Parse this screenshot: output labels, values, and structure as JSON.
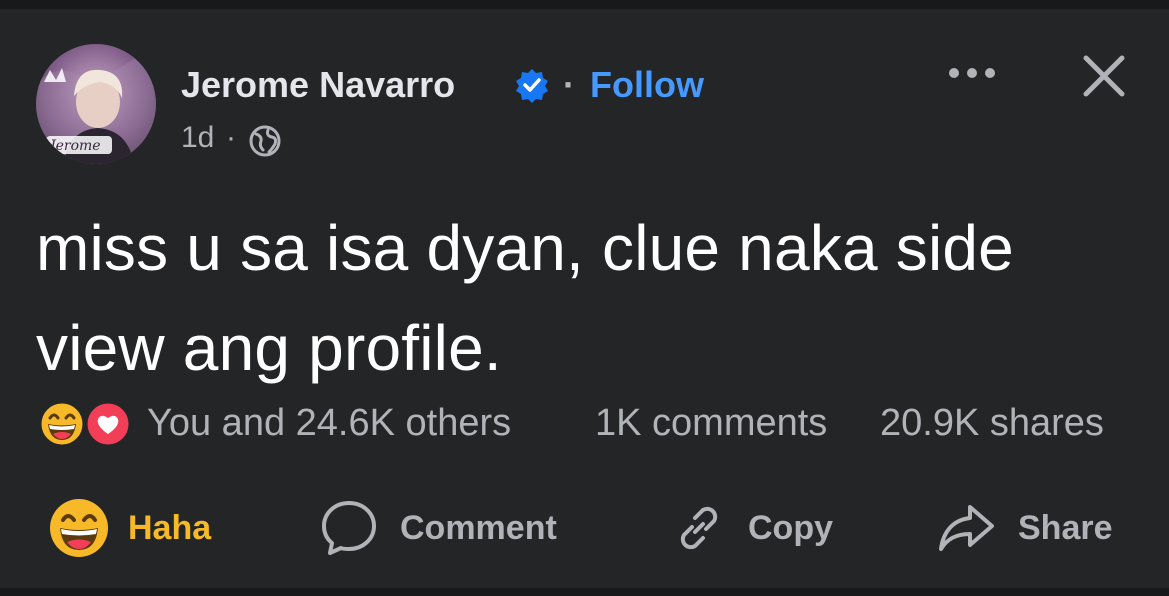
{
  "post": {
    "author": "Jerome Navarro",
    "separator": "·",
    "follow_label": "Follow",
    "time": "1d",
    "time_separator": "·",
    "avatar_text": "Jerome",
    "text": "miss u sa isa dyan, clue naka side view ang profile."
  },
  "stats": {
    "reactions": "You and 24.6K others",
    "comments": "1K comments",
    "shares": "20.9K shares"
  },
  "actions": {
    "haha": "Haha",
    "comment": "Comment",
    "copy": "Copy",
    "share": "Share"
  },
  "colors": {
    "background": "#242526",
    "accent": "#4599ff",
    "haha": "#f7b928",
    "love": "#f33e58",
    "muted": "#b0b3b8"
  },
  "icons": {
    "verified": "verified-badge-icon",
    "globe": "globe-icon",
    "more": "more-options-icon",
    "close": "close-icon",
    "haha": "haha-reaction-icon",
    "love": "love-reaction-icon",
    "comment": "comment-icon",
    "copy": "link-icon",
    "share": "share-icon"
  }
}
